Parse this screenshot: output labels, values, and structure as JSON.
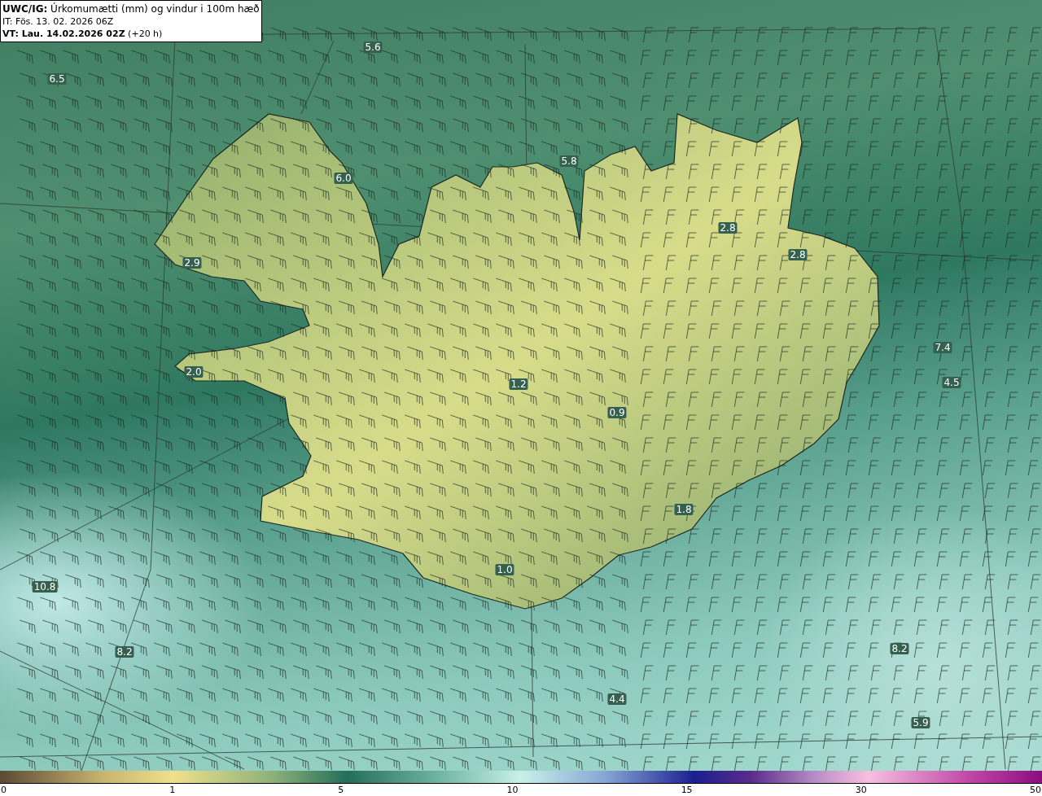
{
  "header": {
    "lines": [
      "**UWC/IG:** Úrkomumætti (mm) og vindur i 100m hæð",
      "IT: Fös. 13. 02. 2026 06Z",
      "**VT: Lau. 14.02.2026 02Z** (+20 h)"
    ]
  },
  "map": {
    "value_labels": [
      "5.6",
      "6.5",
      "6.0",
      "5.8",
      "2.8",
      "2.8",
      "2.9",
      "2.0",
      "1.2",
      "0.9",
      "1.8",
      "1.0",
      "7.4",
      "4.5",
      "10.8",
      "8.2",
      "8.2",
      "4.4",
      "5.9"
    ]
  },
  "colorbar": {
    "ticks": [
      "0",
      "1",
      "5",
      "10",
      "15",
      "30",
      "50"
    ]
  }
}
